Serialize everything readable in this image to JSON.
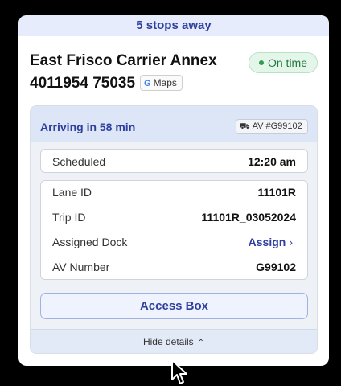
{
  "banner": {
    "text": "5 stops away"
  },
  "location": {
    "name": "East Frisco Carrier Annex",
    "tracking_number": "4011954 75035",
    "maps_label": "Maps",
    "maps_icon": "google-g-icon"
  },
  "status": {
    "label": "On time",
    "color": "#2f9e55"
  },
  "details": {
    "arriving_text": "Arriving in 58 min",
    "av_badge": "AV #G99102",
    "av_icon": "truck-icon",
    "scheduled": {
      "label": "Scheduled",
      "value": "12:20 am"
    },
    "rows": [
      {
        "label": "Lane ID",
        "value": "11101R"
      },
      {
        "label": "Trip ID",
        "value": "11101R_03052024"
      },
      {
        "label": "Assigned Dock",
        "value": "Assign"
      },
      {
        "label": "AV Number",
        "value": "G99102"
      }
    ],
    "access_button": "Access Box",
    "hide_details": "Hide details"
  },
  "colors": {
    "accent": "#2f3f9e",
    "banner_bg": "#e6ecfb",
    "success": "#2f9e55"
  }
}
